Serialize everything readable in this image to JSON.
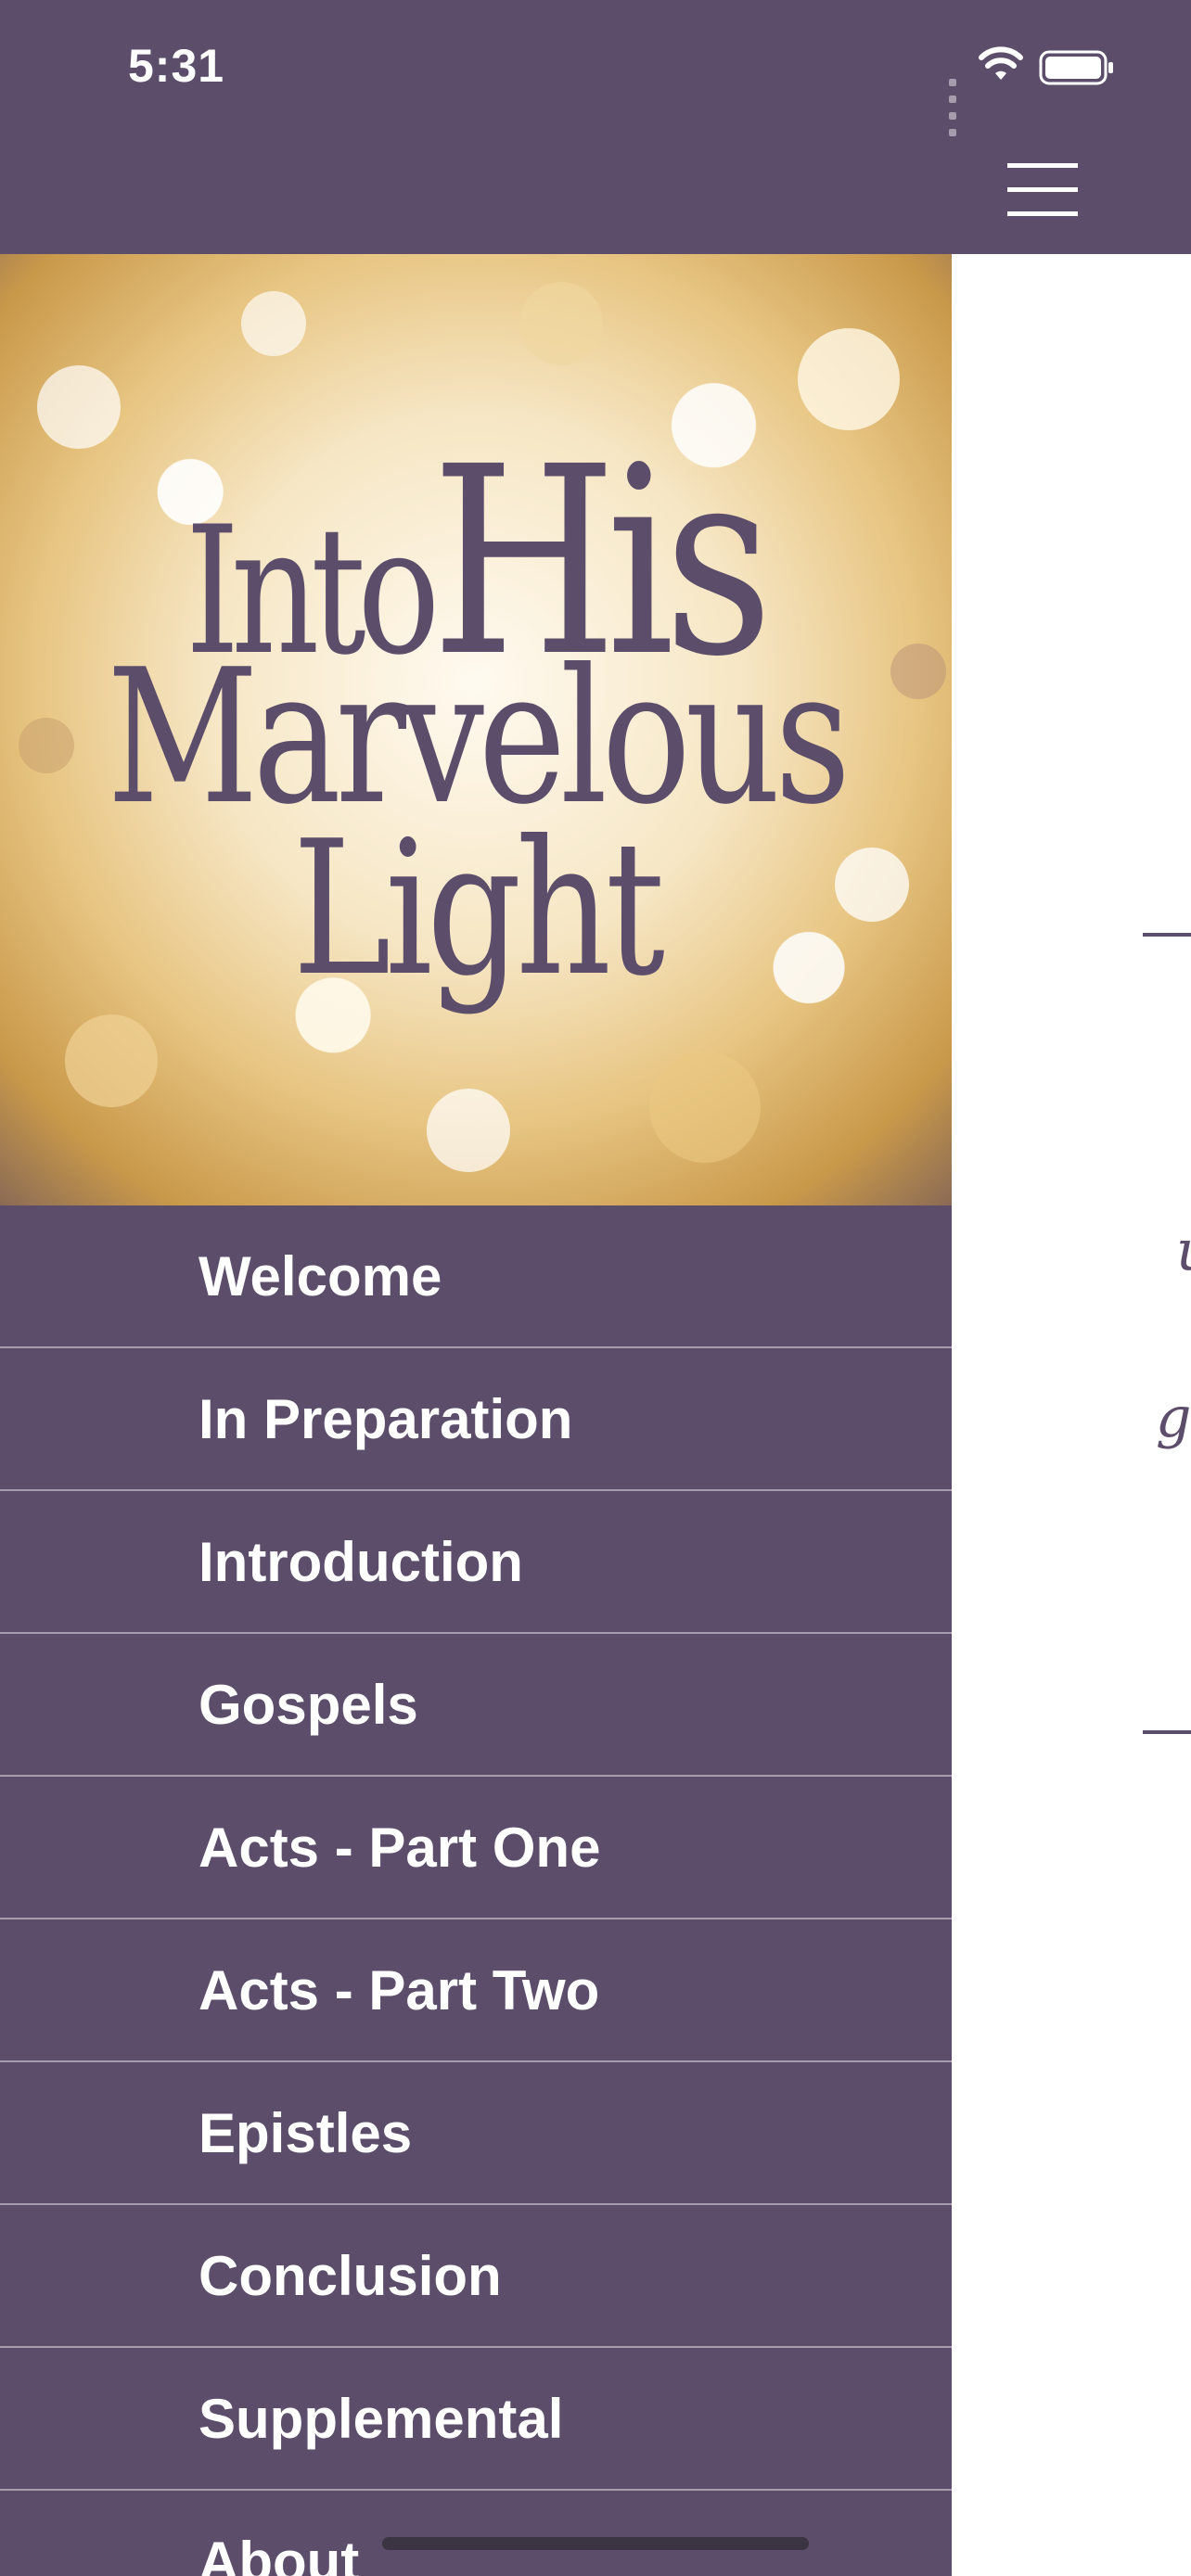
{
  "status_bar": {
    "time": "5:31",
    "signal_icon": "signal-bars-icon",
    "wifi_icon": "wifi-icon",
    "battery_icon": "battery-icon"
  },
  "header": {
    "menu_icon": "hamburger-menu-icon"
  },
  "hero": {
    "logo_words": [
      "Into",
      "His",
      "Marvelous",
      "Light"
    ]
  },
  "nav": {
    "items": [
      {
        "label": "Welcome"
      },
      {
        "label": "In Preparation"
      },
      {
        "label": "Introduction"
      },
      {
        "label": "Gospels"
      },
      {
        "label": "Acts - Part One"
      },
      {
        "label": "Acts - Part Two"
      },
      {
        "label": "Epistles"
      },
      {
        "label": "Conclusion"
      },
      {
        "label": "Supplemental"
      },
      {
        "label": "About"
      }
    ]
  },
  "colors": {
    "brand_purple": "#5c4e6b",
    "text_white": "#ffffff",
    "background": "#ffffff"
  }
}
